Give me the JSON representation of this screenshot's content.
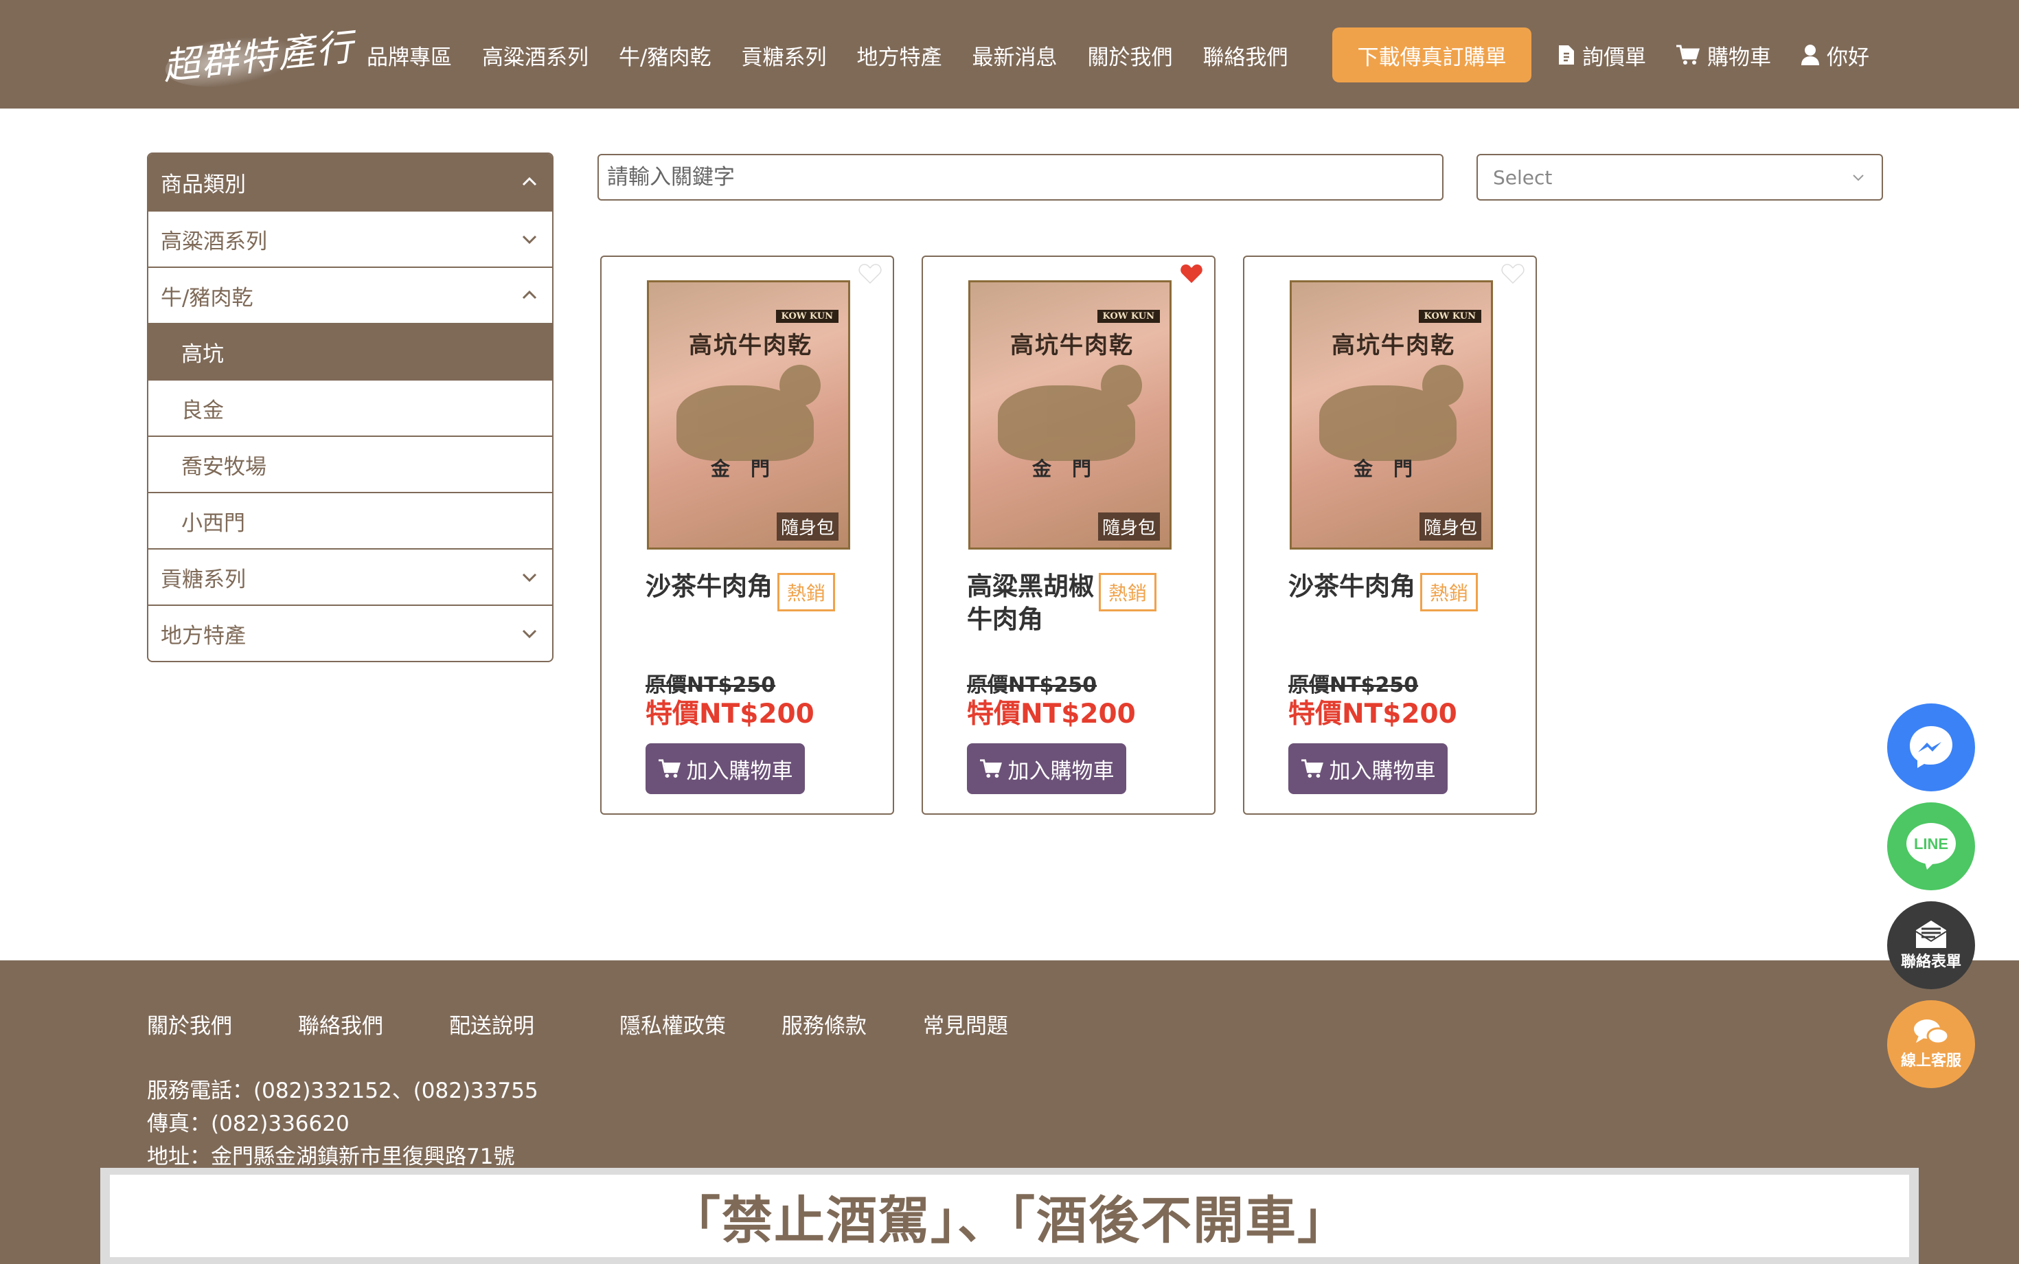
{
  "header": {
    "logo_text": "超群特產行",
    "nav": [
      "品牌專區",
      "高粱酒系列",
      "牛/豬肉乾",
      "貢糖系列",
      "地方特產",
      "最新消息",
      "關於我們",
      "聯絡我們"
    ],
    "fax_button": "下載傳真訂購單",
    "quote": "詢價單",
    "cart": "購物車",
    "user": "你好"
  },
  "sidebar": {
    "header": "商品類別",
    "items": [
      {
        "label": "高粱酒系列"
      },
      {
        "label": "牛/豬肉乾"
      },
      {
        "label": "高坑"
      },
      {
        "label": "良金"
      },
      {
        "label": "喬安牧場"
      },
      {
        "label": "小西門"
      },
      {
        "label": "貢糖系列"
      },
      {
        "label": "地方特產"
      }
    ]
  },
  "search": {
    "placeholder": "請輸入關鍵字"
  },
  "sort_select": {
    "value": "Select"
  },
  "product_image": {
    "title": "高坑牛肉乾",
    "brand_tag": "KOW KUN",
    "region": "金門",
    "pack": "隨身包"
  },
  "products": [
    {
      "name": "沙茶牛肉角",
      "badge": "熱銷",
      "original_price": "原價NT$250",
      "sale_price": "特價NT$200",
      "button": "加入購物車",
      "favorited": false
    },
    {
      "name": "高粱黑胡椒牛肉角",
      "badge": "熱銷",
      "original_price": "原價NT$250",
      "sale_price": "特價NT$200",
      "button": "加入購物車",
      "favorited": true
    },
    {
      "name": "沙茶牛肉角",
      "badge": "熱銷",
      "original_price": "原價NT$250",
      "sale_price": "特價NT$200",
      "button": "加入購物車",
      "favorited": false
    }
  ],
  "floating": {
    "line": "LINE",
    "form": "聯絡表單",
    "cs": "線上客服"
  },
  "footer": {
    "links": [
      "關於我們",
      "聯絡我們",
      "配送說明",
      "隱私權政策",
      "服務條款",
      "常見問題"
    ],
    "phone": "服務電話：(082)332152、(082)33755",
    "fax": "傳真：(082)336620",
    "address": "地址：金門縣金湖鎮新市里復興路71號"
  },
  "warning": "「禁止酒駕」、「酒後不開車」",
  "colors": {
    "brand": "#7f6a58",
    "accent": "#f0a24a",
    "sale": "#e53d2e",
    "button": "#6c5278",
    "favorite": "#e53d2e"
  }
}
